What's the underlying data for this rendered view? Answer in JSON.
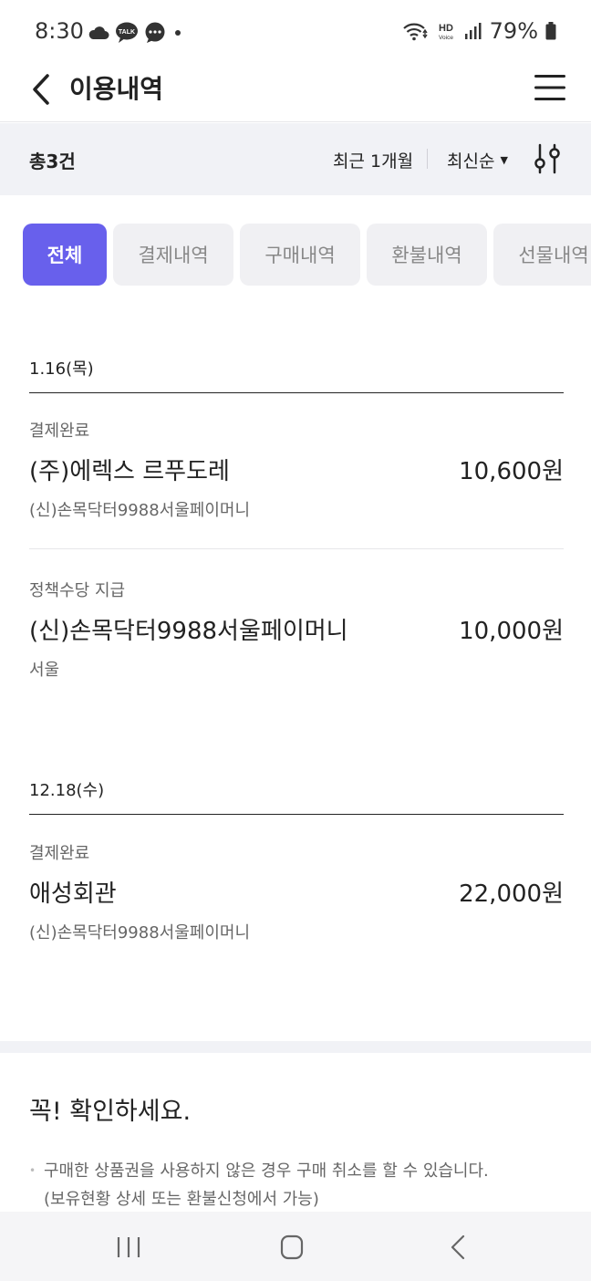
{
  "status_bar": {
    "time": "8:30",
    "notification_icons": [
      "cloud-icon",
      "kakaotalk-icon",
      "chat-icon",
      "dot-icon"
    ],
    "right_icons": [
      "wifi-icon",
      "hd-voice-icon",
      "signal-icon"
    ],
    "battery": "79%"
  },
  "header": {
    "title": "이용내역",
    "back_icon": "chevron-left-icon",
    "menu_icon": "hamburger-menu-icon"
  },
  "filter_bar": {
    "total": "총3건",
    "period": "최근 1개월",
    "sort": "최신순",
    "sort_icon": "caret-down-icon",
    "filter_icon": "filter-sliders-icon"
  },
  "tabs": [
    {
      "label": "전체",
      "active": true
    },
    {
      "label": "결제내역",
      "active": false
    },
    {
      "label": "구매내역",
      "active": false
    },
    {
      "label": "환불내역",
      "active": false
    },
    {
      "label": "선물내역",
      "active": false
    }
  ],
  "groups": [
    {
      "date": "1.16(목)",
      "items": [
        {
          "status": "결제완료",
          "name": "(주)에렉스 르푸도레",
          "amount": "10,600원",
          "sub": "(신)손목닥터9988서울페이머니"
        },
        {
          "status": "정책수당 지급",
          "name": "(신)손목닥터9988서울페이머니",
          "amount": "10,000원",
          "sub": "서울"
        }
      ]
    },
    {
      "date": "12.18(수)",
      "items": [
        {
          "status": "결제완료",
          "name": "애성회관",
          "amount": "22,000원",
          "sub": "(신)손목닥터9988서울페이머니"
        }
      ]
    }
  ],
  "notice": {
    "title": "꼭! 확인하세요.",
    "items": [
      {
        "line1": "구매한 상품권을 사용하지 않은 경우 구매 취소를 할 수 있습니다.",
        "line2": "(보유현황 상세 또는 환불신청에서 가능)"
      }
    ]
  },
  "nav_bar": {
    "icons": [
      "recent-apps-icon",
      "home-icon",
      "back-icon"
    ]
  },
  "colors": {
    "accent": "#6860ec",
    "tab_inactive_bg": "#f0f0f3",
    "filter_bg": "#f1f2f6"
  }
}
